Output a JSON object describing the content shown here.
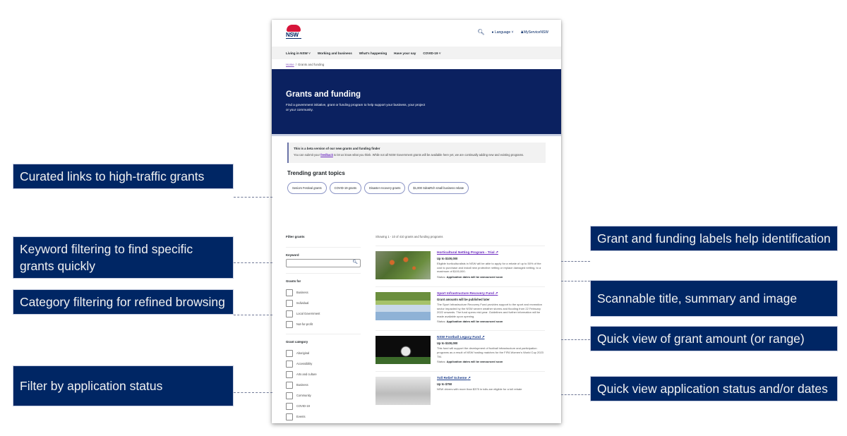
{
  "site": {
    "logo_text": "NSW",
    "search_icon": "search-icon",
    "language_label": "Language",
    "account_label": "MyServiceNSW"
  },
  "nav": {
    "items": [
      {
        "label": "Living in NSW",
        "has_dropdown": true
      },
      {
        "label": "Working and business",
        "has_dropdown": false
      },
      {
        "label": "What's happening",
        "has_dropdown": false
      },
      {
        "label": "Have your say",
        "has_dropdown": false
      },
      {
        "label": "COVID-19",
        "has_dropdown": true
      }
    ]
  },
  "breadcrumb": {
    "home": "Home",
    "separator": "/",
    "current": "Grants and funding"
  },
  "hero": {
    "title": "Grants and funding",
    "description": "Find a government initiative, grant or funding program to help support your business, your project or your community."
  },
  "beta_callout": {
    "title": "This is a beta version of our new grants and funding finder",
    "body_prefix": "You can submit your ",
    "link": "feedback",
    "body_suffix": " to let us know what you think. While not all NSW Government grants will be available here yet, we are continually adding new and existing programs."
  },
  "trending": {
    "title": "Trending grant topics",
    "topics": [
      "Seniors Festival grants",
      "COVID-19 grants",
      "Disaster recovery grants",
      "$1,000 Sdn&Rch small business rebate"
    ]
  },
  "filters": {
    "title": "Filter grants",
    "keyword_label": "Keyword",
    "keyword_value": "",
    "grants_for_label": "Grants for",
    "grants_for": [
      "Business",
      "Individual",
      "Local Government",
      "Not-for-profit"
    ],
    "category_label": "Grant category",
    "categories": [
      "Aboriginal",
      "Accessibility",
      "Arts and culture",
      "Business",
      "Community",
      "COVID-19",
      "Events"
    ]
  },
  "results": {
    "count_text": "Showing 1 - 10 of 410 grants and funding programs",
    "items": [
      {
        "title": "Horticultural Netting Program - Trial",
        "amount": "Up to $100,000",
        "summary": "Eligible horticulturalists in NSW will be able to apply for a rebate of up to 50% of the cost to purchase and install new protective netting or replace damaged netting, to a maximum of $100,000.",
        "status_label": "Status:",
        "status": "Application dates will be announced soon",
        "image": "netting-photo"
      },
      {
        "title": "Sport Infrastructure Recovery Fund",
        "amount": "Grant amounts will be published later",
        "summary": "The Sport Infrastructure Recovery Fund provides support to the sport and recreation sector impacted by the NSW severe weather storms and flooding from 22 February 2022 onwards. The fund opens mid-year. Guidelines and further information will be made available upon opening.",
        "status_label": "Status:",
        "status": "Application dates will be announced soon",
        "image": "flooded-field-photo"
      },
      {
        "title": "NSW Football Legacy Fund",
        "amount": "Up to $100,000",
        "summary": "This fund will support the development of football infrastructure and participation programs as a result of NSW hosting matches for the FIFA Women's World Cup 2023 TM.",
        "status_label": "Status:",
        "status": "Application dates will be announced soon",
        "image": "football-photo"
      },
      {
        "title": "Toll Relief Scheme",
        "amount": "Up to $750",
        "summary": "NSW drivers with more than $375 in tolls are eligible for a toll rebate",
        "status_label": "",
        "status": "",
        "image": "toll-gantry-photo"
      }
    ]
  },
  "annotations": {
    "left": [
      "Curated links to high-traffic grants",
      "Keyword filtering to find specific grants quickly",
      "Category filtering for refined browsing",
      "Filter by application status"
    ],
    "right": [
      "Grant and funding labels help identification",
      "Scannable title, summary and image",
      "Quick view of grant amount (or range)",
      "Quick view application status and/or dates"
    ]
  }
}
